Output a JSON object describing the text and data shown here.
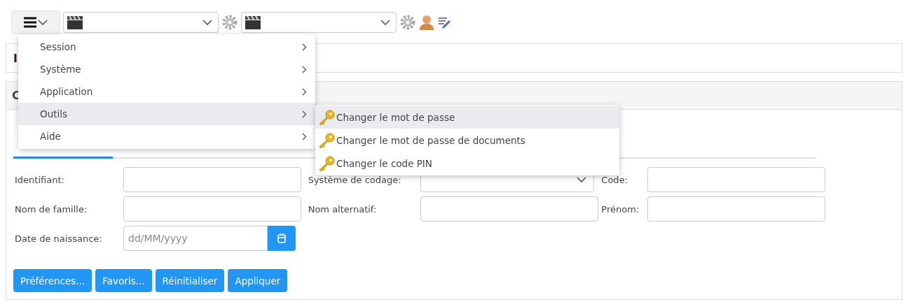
{
  "toolbar": {
    "menu_open": true,
    "selects": [
      {
        "kind": "select"
      },
      {
        "kind": "select"
      }
    ]
  },
  "panels": [
    {
      "title": "I"
    },
    {
      "title": "C"
    }
  ],
  "tabs": [
    {
      "selected": true
    }
  ],
  "form": {
    "rows": [
      {
        "fields": [
          {
            "label": "Identifiant:",
            "kind": "text"
          },
          {
            "label": "Système de codage:",
            "kind": "select"
          },
          {
            "label": "Code:",
            "kind": "text"
          }
        ]
      },
      {
        "fields": [
          {
            "label": "Nom de famille:",
            "kind": "text"
          },
          {
            "label": "Nom alternatif:",
            "kind": "text"
          },
          {
            "label": "Prénom:",
            "kind": "text"
          }
        ]
      },
      {
        "fields": [
          {
            "label": "Date de naissance:",
            "kind": "date",
            "placeholder": "dd/MM/yyyy"
          }
        ]
      }
    ]
  },
  "buttons": [
    "Préférences...",
    "Favoris...",
    "Réinitialiser",
    "Appliquer"
  ],
  "menu": {
    "items": [
      {
        "label": "Session",
        "selected": false
      },
      {
        "label": "Système",
        "selected": false
      },
      {
        "label": "Application",
        "selected": false
      },
      {
        "label": "Outils",
        "selected": true,
        "children": [
          {
            "label": "Changer le mot de passe",
            "selected": true
          },
          {
            "label": "Changer le mot de passe de documents",
            "selected": false
          },
          {
            "label": "Changer le code PIN",
            "selected": false
          }
        ]
      },
      {
        "label": "Aide",
        "selected": false
      }
    ]
  }
}
